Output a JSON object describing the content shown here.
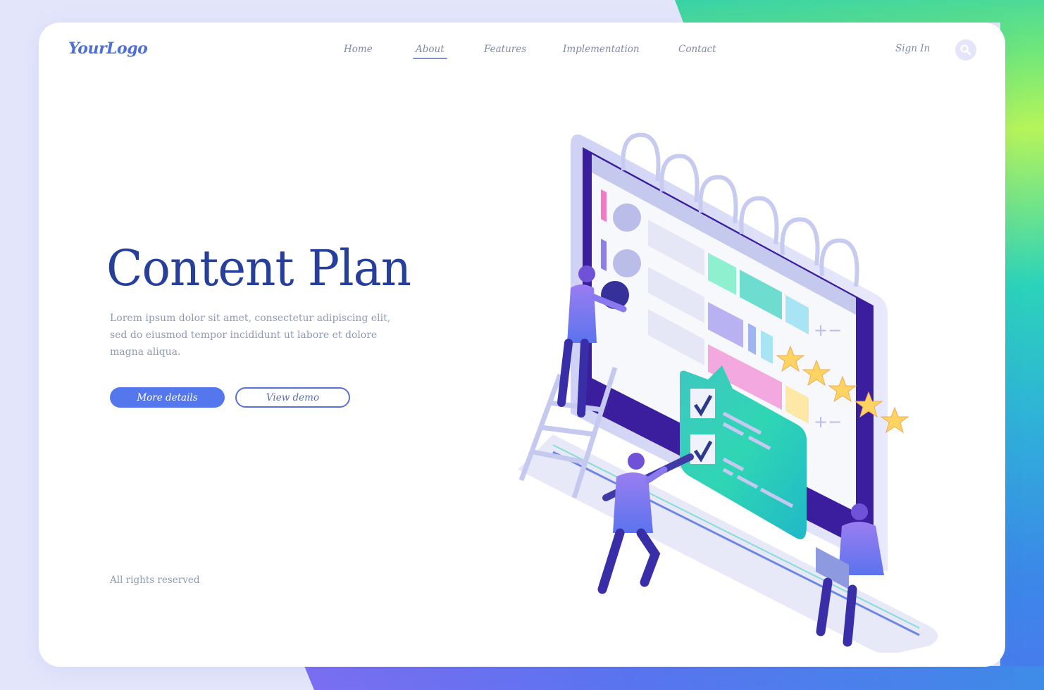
{
  "brand": {
    "logo": "YourLogo"
  },
  "nav": {
    "items": [
      {
        "label": "Home",
        "active": false
      },
      {
        "label": "About",
        "active": true
      },
      {
        "label": "Features",
        "active": false
      },
      {
        "label": "Implementation",
        "active": false
      },
      {
        "label": "Contact",
        "active": false
      }
    ],
    "sign_in": "Sign In",
    "search_icon": "search-icon"
  },
  "hero": {
    "title": "Content Plan",
    "description": "Lorem ipsum dolor sit amet, consectetur adipiscing elit, sed do eiusmod tempor incididunt ut labore et dolore magna aliqua.",
    "primary_button": "More details",
    "secondary_button": "View demo"
  },
  "footer": {
    "copyright": "All rights reserved"
  },
  "illustration": {
    "subject": "isometric content-plan calendar with people",
    "rating_stars": 5,
    "checked_items": 2
  },
  "colors": {
    "accent": "#5577ee",
    "title": "#263f9a",
    "logo": "#4d6fd6",
    "nav_text": "#7f8ba6",
    "body_text": "#8d9bb5",
    "page_bg": "#e3e5fb"
  }
}
